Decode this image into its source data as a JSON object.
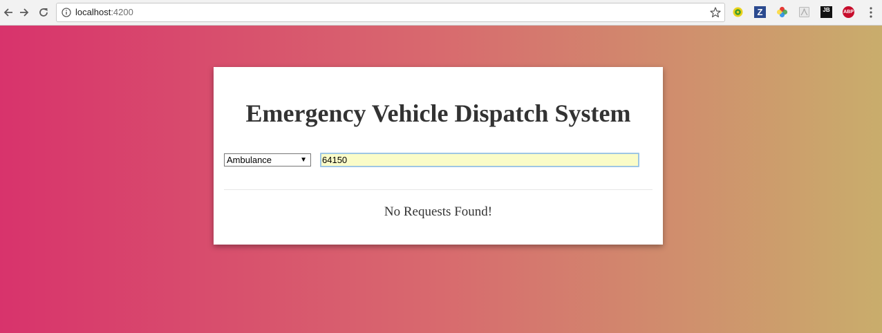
{
  "browser": {
    "url_host": "localhost",
    "url_port": ":4200",
    "icons": {
      "back": "back-arrow-icon",
      "forward": "forward-arrow-icon",
      "reload": "reload-icon",
      "info": "info-icon",
      "bookmark": "star-icon",
      "menu": "menu-dots-icon"
    },
    "extensions": {
      "z_label": "Z",
      "jb_label": "JB",
      "abp_label": "ABP"
    }
  },
  "theme": {
    "gradient_start": "#d8336c",
    "gradient_mid": "#d86a6e",
    "gradient_end": "#c9ad6c",
    "card_bg": "#ffffff",
    "text_color": "#333333",
    "input_bg": "#fafcc8"
  },
  "card": {
    "title": "Emergency Vehicle Dispatch System",
    "vehicle_select": {
      "selected": "Ambulance",
      "arrow": "▼"
    },
    "zip_input": {
      "value": "64150"
    },
    "empty_message": "No Requests Found!"
  }
}
